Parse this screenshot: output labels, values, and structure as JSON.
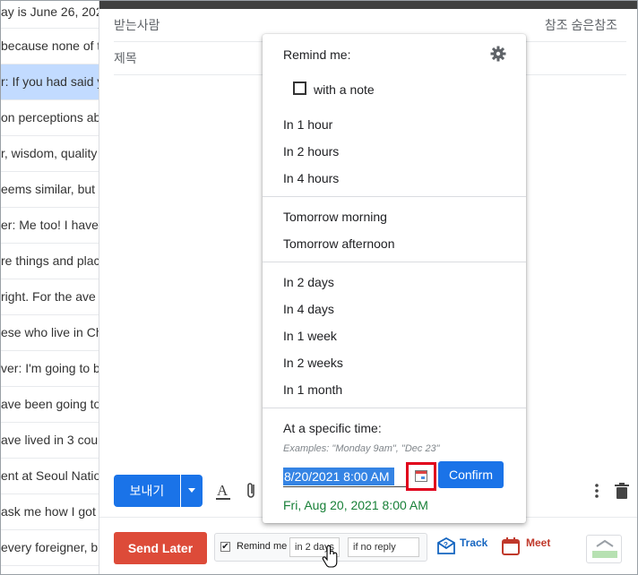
{
  "email_list": [
    {
      "text": "ay is June 26, 202",
      "selected": false
    },
    {
      "text": "because none of t",
      "selected": false
    },
    {
      "text": "r: If you had said y",
      "selected": true
    },
    {
      "text": "on perceptions ab",
      "selected": false
    },
    {
      "text": "r, wisdom, quality",
      "selected": false
    },
    {
      "text": "eems similar, but",
      "selected": false
    },
    {
      "text": "er: Me too! I have",
      "selected": false
    },
    {
      "text": "re things and plac",
      "selected": false
    },
    {
      "text": "right. For the ave",
      "selected": false
    },
    {
      "text": "ese who live in Ch",
      "selected": false
    },
    {
      "text": "ver: I'm going to b",
      "selected": false
    },
    {
      "text": "ave been going to",
      "selected": false
    },
    {
      "text": "ave lived in 3 cou",
      "selected": false
    },
    {
      "text": "ent at Seoul Natio",
      "selected": false
    },
    {
      "text": " ask me how I got",
      "selected": false
    },
    {
      "text": "every foreigner, bu",
      "selected": false
    }
  ],
  "compose": {
    "to_label": "받는사람",
    "cc_bcc": "참조 숨은참조",
    "subject_label": "제목",
    "send_label": "보내기"
  },
  "bottom": {
    "send_later": "Send Later",
    "remind_label": "Remind me",
    "remind_days": "in 2 days",
    "remind_condition": "if no reply",
    "track": "Track",
    "meet": "Meet"
  },
  "popup": {
    "title": "Remind me:",
    "with_note": "with a note",
    "group1": [
      "In 1 hour",
      "In 2 hours",
      "In 4 hours"
    ],
    "group2": [
      "Tomorrow morning",
      "Tomorrow afternoon"
    ],
    "group3": [
      "In 2 days",
      "In 4 days",
      "In 1 week",
      "In 2 weeks",
      "In 1 month"
    ],
    "specific_title": "At a specific time:",
    "examples": "Examples: \"Monday 9am\", \"Dec 23\"",
    "date_value": "8/20/2021 8:00 AM",
    "confirm": "Confirm",
    "parsed": "Fri, Aug 20, 2021 8:00 AM"
  },
  "colors": {
    "send_blue": "#1a73e8",
    "send_later_red": "#dd4b39",
    "parsed_green": "#188038",
    "highlight_red": "#e0001b"
  }
}
